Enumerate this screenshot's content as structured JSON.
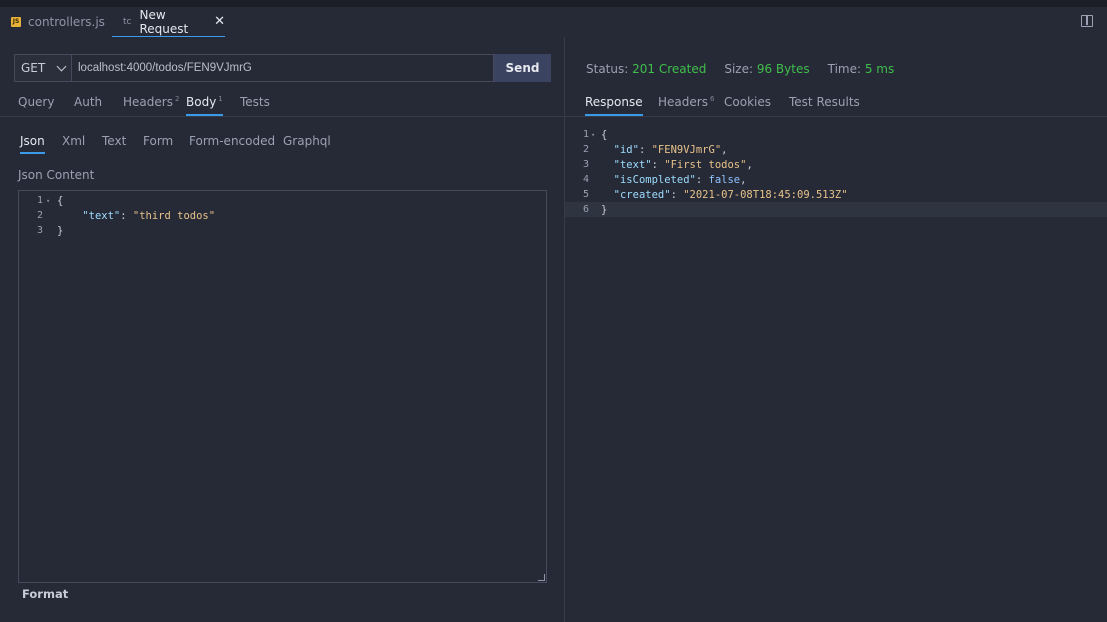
{
  "tabs": [
    {
      "badge": "JS",
      "label": "controllers.js"
    },
    {
      "badge": "tc",
      "label": "New Request",
      "close": "✕"
    }
  ],
  "request": {
    "method": "GET",
    "url": "localhost:4000/todos/FEN9VJmrG",
    "send_label": "Send",
    "tabs": [
      {
        "label": "Query"
      },
      {
        "label": "Auth"
      },
      {
        "label": "Headers",
        "count": "2"
      },
      {
        "label": "Body",
        "count": "1"
      },
      {
        "label": "Tests"
      }
    ],
    "body_tabs": [
      "Json",
      "Xml",
      "Text",
      "Form",
      "Form-encoded",
      "Graphql"
    ],
    "json_label": "Json Content",
    "editor_lines": [
      {
        "n": "1",
        "fold": "▾",
        "text": "{"
      },
      {
        "n": "2",
        "key": "\"text\"",
        "value": "\"third todos\""
      },
      {
        "n": "3",
        "text": "}"
      }
    ],
    "format_label": "Format"
  },
  "response": {
    "status_label": "Status:",
    "status_value": "201 Created",
    "size_label": "Size:",
    "size_value": "96 Bytes",
    "time_label": "Time:",
    "time_value": "5 ms",
    "tabs": [
      {
        "label": "Response"
      },
      {
        "label": "Headers",
        "count": "6"
      },
      {
        "label": "Cookies"
      },
      {
        "label": "Test Results"
      }
    ],
    "lines": [
      {
        "n": "1",
        "fold": "▾",
        "text": "{"
      },
      {
        "n": "2",
        "key": "\"id\"",
        "value": "\"FEN9VJmrG\"",
        "tail": ","
      },
      {
        "n": "3",
        "key": "\"text\"",
        "value": "\"First todos\"",
        "tail": ","
      },
      {
        "n": "4",
        "key": "\"isCompleted\"",
        "value": "false",
        "tail": ","
      },
      {
        "n": "5",
        "key": "\"created\"",
        "value": "\"2021-07-08T18:45:09.513Z\""
      },
      {
        "n": "6",
        "text": "}"
      }
    ]
  },
  "colors": {
    "accent": "#3b9be8",
    "success": "#3fbf4b",
    "send_bg": "#3a4360"
  }
}
